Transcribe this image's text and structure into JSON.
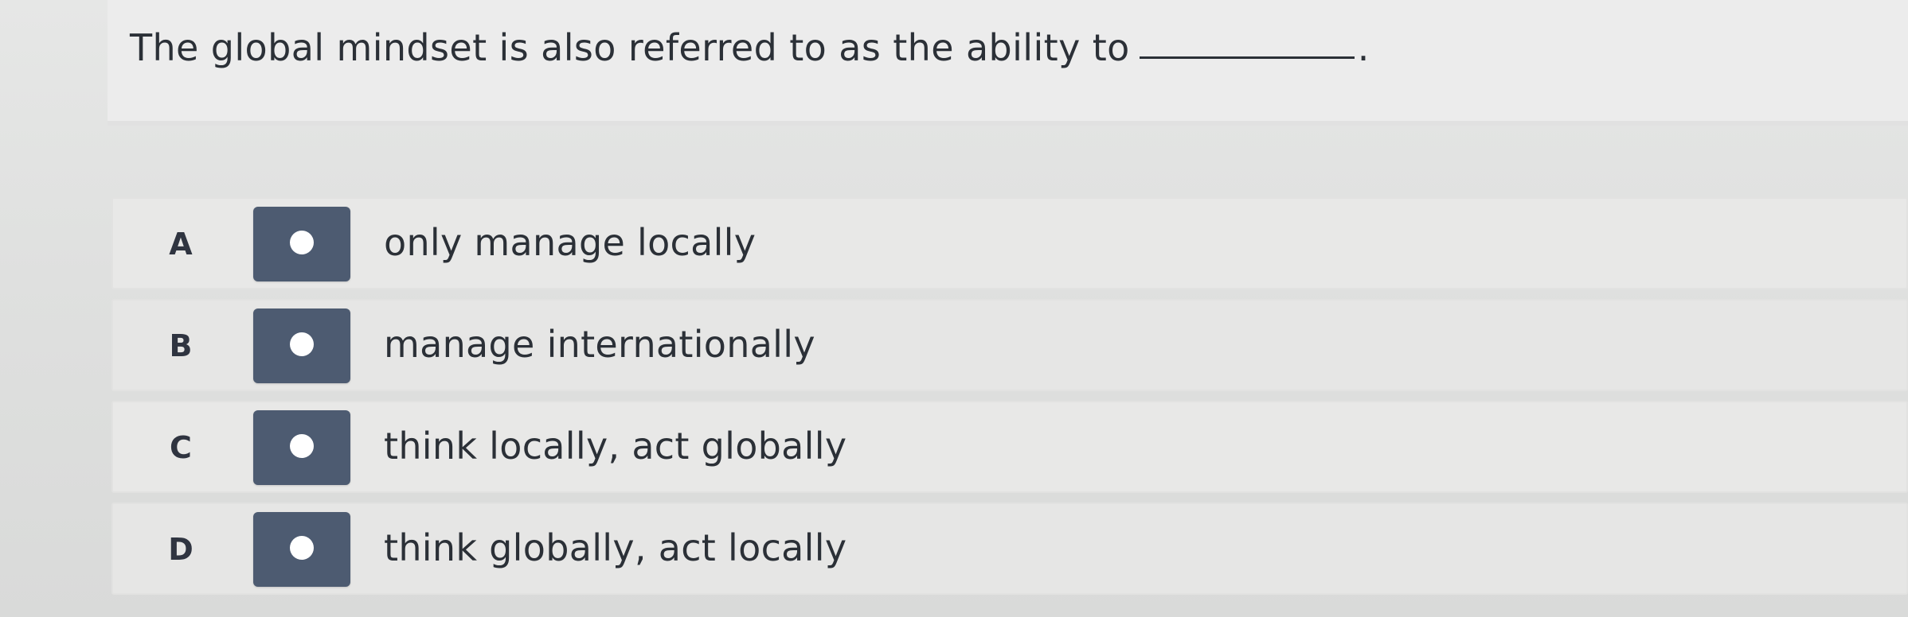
{
  "question": {
    "text": "The global mindset is also referred to as the ability to",
    "period": "."
  },
  "options": [
    {
      "letter": "A",
      "text": "only manage locally"
    },
    {
      "letter": "B",
      "text": "manage internationally"
    },
    {
      "letter": "C",
      "text": "think locally, act globally"
    },
    {
      "letter": "D",
      "text": "think globally, act locally"
    }
  ],
  "colors": {
    "radio_box": "#4d5b71",
    "radio_dot": "#ffffff",
    "text": "#2b3037"
  }
}
